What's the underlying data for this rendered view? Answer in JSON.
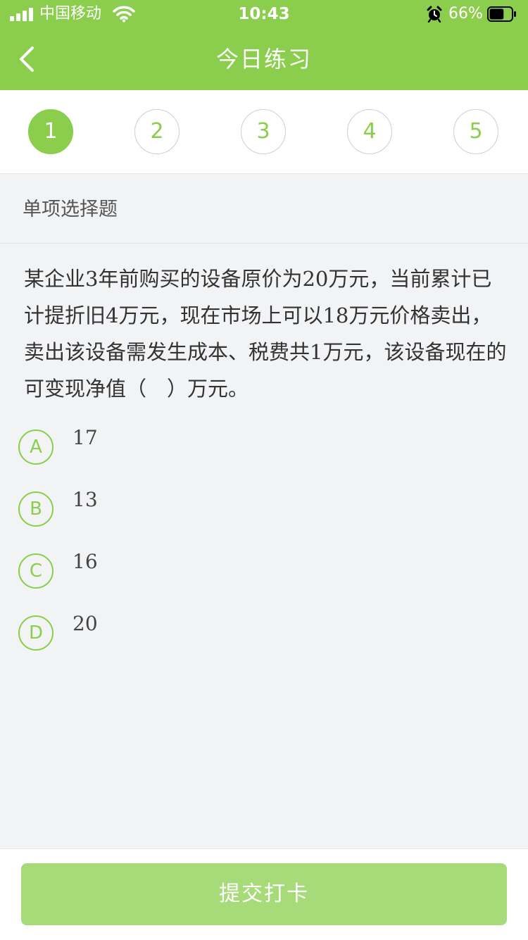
{
  "status_bar": {
    "carrier": "中国移动",
    "time": "10:43",
    "battery": "66%",
    "battery_level": 0.66
  },
  "nav": {
    "title": "今日练习",
    "back_icon": "chevron-left-icon"
  },
  "steps": [
    {
      "label": "1",
      "active": true
    },
    {
      "label": "2",
      "active": false
    },
    {
      "label": "3",
      "active": false
    },
    {
      "label": "4",
      "active": false
    },
    {
      "label": "5",
      "active": false
    }
  ],
  "question": {
    "type": "单项选择题",
    "text": "某企业3年前购买的设备原价为20万元，当前累计已计提折旧4万元，现在市场上可以18万元价格卖出，卖出该设备需发生成本、税费共1万元，该设备现在的可变现净值（　）万元。",
    "options": [
      {
        "letter": "A",
        "text": "17"
      },
      {
        "letter": "B",
        "text": "13"
      },
      {
        "letter": "C",
        "text": "16"
      },
      {
        "letter": "D",
        "text": "20"
      }
    ]
  },
  "footer": {
    "submit_label": "提交打卡"
  },
  "colors": {
    "accent": "#8bcd4c",
    "submit": "#a7da78",
    "background": "#f2f3f5"
  }
}
